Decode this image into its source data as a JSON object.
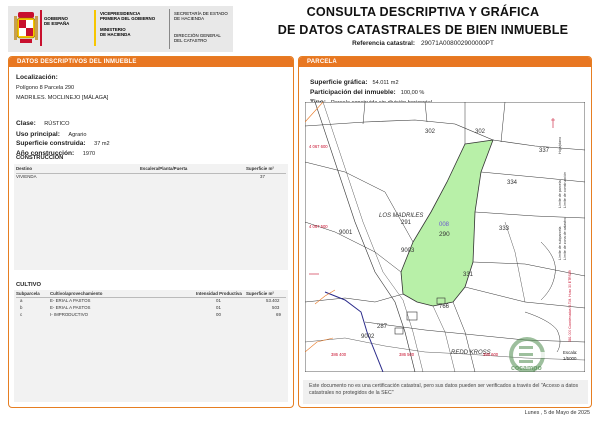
{
  "header": {
    "gov_name": [
      "GOBIERNO",
      "DE ESPAÑA"
    ],
    "vice_presidency": [
      "VICEPRESIDENCIA",
      "PRIMERA DEL GOBIERNO"
    ],
    "ministry": [
      "MINISTERIO",
      "DE HACIENDA"
    ],
    "secretaria": [
      "SECRETARÍA DE ESTADO",
      "DE HACIENDA"
    ],
    "direccion": [
      "DIRECCIÓN GENERAL",
      "DEL CATASTRO"
    ],
    "title_line1": "CONSULTA DESCRIPTIVA Y GRÁFICA",
    "title_line2": "DE DATOS CATASTRALES DE BIEN INMUEBLE",
    "ref_label": "Referencia catastral:",
    "ref_value": "29071A008002900000PT"
  },
  "left": {
    "bar_title": "DATOS DESCRIPTIVOS DEL INMUEBLE",
    "localizacion_label": "Localización:",
    "localizacion_lines": [
      "Polígono 8 Parcela 290",
      "MADRILES. MOCLINEJO [MÁLAGA]"
    ],
    "clase_label": "Clase:",
    "clase_value": "RÚSTICO",
    "uso_label": "Uso principal:",
    "uso_value": "Agrario",
    "sup_label": "Superficie construida:",
    "sup_value": "37 m2",
    "anio_label": "Año construcción:",
    "anio_value": "1970",
    "construccion": {
      "title": "CONSTRUCCIÓN",
      "headers": [
        "Destino",
        "Escalera/Planta/Puerta",
        "Superficie m²"
      ],
      "rows": [
        [
          "VIVIENDA",
          "",
          "37"
        ]
      ]
    },
    "cultivo": {
      "title": "CULTIVO",
      "headers": [
        "Subparcela",
        "Cultivo/aprovechamiento",
        "Intensidad Productiva",
        "Superficie m²"
      ],
      "rows": [
        [
          "a",
          "E- ERIAL A PASTOS",
          "01",
          "53.402"
        ],
        [
          "b",
          "E- ERIAL A PASTOS",
          "01",
          "503"
        ],
        [
          "c",
          "I- IMPRODUCTIVO",
          "00",
          "69"
        ]
      ]
    }
  },
  "right": {
    "bar_title": "PARCELA",
    "sup_grafica_label": "Superficie gráfica:",
    "sup_grafica_value": "54.011 m2",
    "participacion_label": "Participación del inmueble:",
    "participacion_value": "100,00 %",
    "tipo_label": "Tipo:",
    "tipo_value": "Parcela construida sin división horizontal",
    "map": {
      "labels": {
        "p302a": "302",
        "p302b": "302",
        "p337": "337",
        "p334": "334",
        "p333": "333",
        "p331": "331",
        "p766": "766",
        "p287": "287",
        "p9001": "9001",
        "p9003": "9003",
        "p9002": "9002",
        "place": "LOS MADRILES",
        "p291": "291",
        "p008": "008",
        "p290": "290",
        "road": "REDD KROSS",
        "coord_y1": "4 067 600",
        "coord_y2": "4 067 500",
        "coord_x1": "386 400",
        "coord_x2": "386 500",
        "coord_x3": "386 600",
        "scale_label": "Escala:",
        "scale_value": "1/5000",
        "watermark": "cocampo"
      },
      "legend": [
        "Hoja/plano",
        "Límite de parcela",
        "Límite de construcción",
        "Límite de subparcela",
        "Límite de zona de catastro"
      ],
      "side_text": "381 000 Coordenadas U.T.M. Huso 30 ETRS89"
    },
    "note": "Este documento no es una certificación catastral, pero sus datos pueden ser verificados a través del \"Acceso a datos catastrales no protegidos de la SEC\"",
    "date": "Lunes , 5 de Mayo de 2025"
  }
}
